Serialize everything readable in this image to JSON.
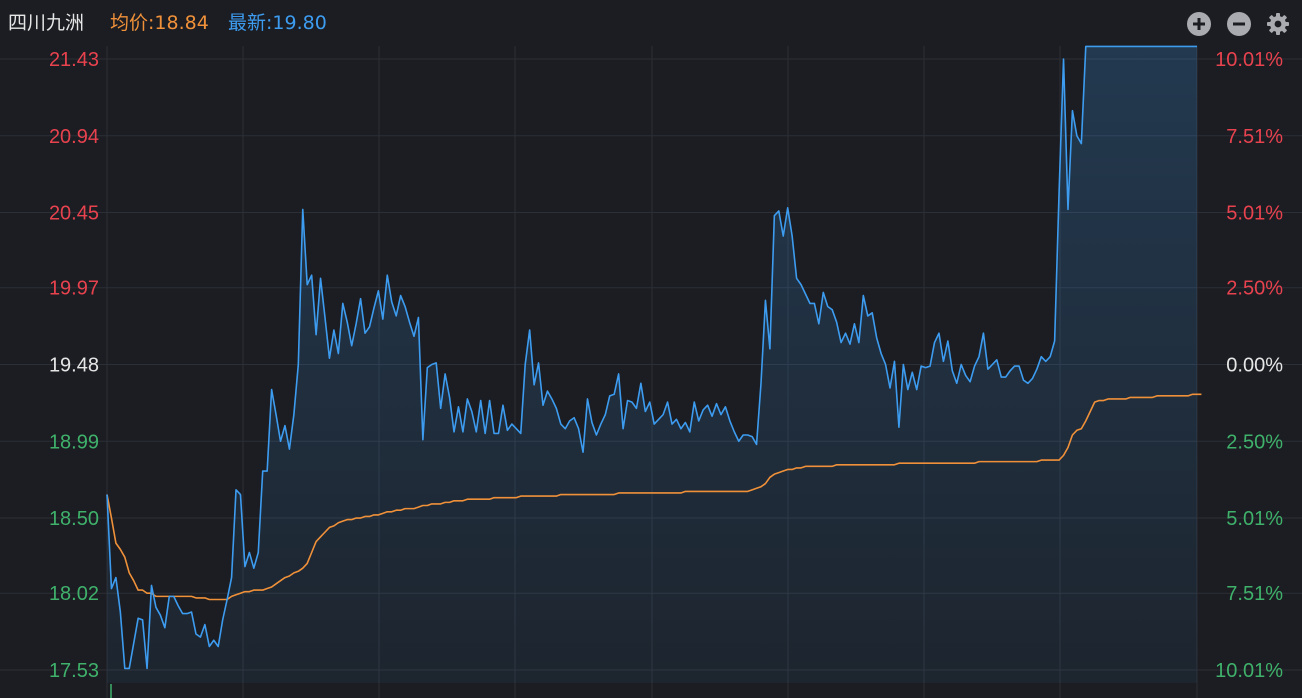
{
  "header": {
    "stock_name": "四川九洲",
    "avg_price_text": "均价:18.84",
    "latest_price_text": "最新:19.80"
  },
  "icons": {
    "zoom_in": "plus-circle-icon",
    "zoom_out": "minus-circle-icon",
    "settings": "gear-icon"
  },
  "colors": {
    "background": "#1b1d22",
    "price_line": "#3d9cf0",
    "avg_line": "#f0913a",
    "up": "#e8424f",
    "down": "#3fb16b",
    "neutral": "#e6e6e6",
    "grid": "#2c2f36"
  },
  "chart_data": {
    "type": "line",
    "title": "",
    "xlabel": "",
    "ylabel": "",
    "prev_close": 19.48,
    "ylim": [
      17.53,
      21.43
    ],
    "y_ticks_left": [
      "21.43",
      "20.94",
      "20.45",
      "19.97",
      "19.48",
      "18.99",
      "18.50",
      "18.02",
      "17.53"
    ],
    "y_ticks_left_values": [
      21.43,
      20.94,
      20.45,
      19.97,
      19.48,
      18.99,
      18.5,
      18.02,
      17.53
    ],
    "y_ticks_right": [
      "10.01%",
      "7.51%",
      "5.01%",
      "2.50%",
      "0.00%",
      "2.50%",
      "5.01%",
      "7.51%",
      "10.01%"
    ],
    "y_ticks_right_sign": [
      "up",
      "up",
      "up",
      "up",
      "neutral",
      "down",
      "down",
      "down",
      "down"
    ],
    "grid": true,
    "legend": "none",
    "series": [
      {
        "name": "最新",
        "color": "#3d9cf0",
        "values": [
          18.65,
          18.05,
          18.12,
          17.9,
          17.54,
          17.54,
          17.7,
          17.86,
          17.85,
          17.54,
          18.07,
          17.93,
          17.88,
          17.8,
          18.0,
          18.0,
          17.94,
          17.89,
          17.89,
          17.9,
          17.76,
          17.74,
          17.82,
          17.68,
          17.72,
          17.68,
          17.85,
          17.98,
          18.12,
          18.68,
          18.65,
          18.19,
          18.28,
          18.18,
          18.28,
          18.8,
          18.8,
          19.32,
          19.16,
          18.99,
          19.09,
          18.94,
          19.16,
          19.48,
          20.47,
          19.99,
          20.05,
          19.67,
          20.03,
          19.78,
          19.52,
          19.7,
          19.55,
          19.87,
          19.75,
          19.6,
          19.74,
          19.9,
          19.68,
          19.72,
          19.84,
          19.95,
          19.77,
          20.05,
          19.88,
          19.79,
          19.92,
          19.85,
          19.75,
          19.66,
          19.78,
          19.0,
          19.46,
          19.48,
          19.49,
          19.2,
          19.42,
          19.27,
          19.05,
          19.21,
          19.05,
          19.26,
          19.18,
          19.05,
          19.25,
          19.04,
          19.25,
          19.04,
          19.04,
          19.22,
          19.06,
          19.1,
          19.07,
          19.04,
          19.48,
          19.7,
          19.35,
          19.49,
          19.22,
          19.31,
          19.26,
          19.2,
          19.1,
          19.07,
          19.12,
          19.14,
          19.07,
          18.92,
          19.26,
          19.11,
          19.03,
          19.1,
          19.16,
          19.28,
          19.29,
          19.42,
          19.07,
          19.25,
          19.24,
          19.2,
          19.36,
          19.18,
          19.24,
          19.1,
          19.13,
          19.16,
          19.24,
          19.1,
          19.13,
          19.07,
          19.11,
          19.05,
          19.24,
          19.12,
          19.19,
          19.22,
          19.15,
          19.23,
          19.16,
          19.21,
          19.12,
          19.05,
          18.99,
          19.03,
          19.03,
          19.02,
          18.97,
          19.36,
          19.89,
          19.58,
          20.43,
          20.46,
          20.3,
          20.48,
          20.3,
          20.03,
          19.99,
          19.93,
          19.87,
          19.87,
          19.74,
          19.94,
          19.85,
          19.83,
          19.75,
          19.62,
          19.68,
          19.61,
          19.74,
          19.62,
          19.92,
          19.79,
          19.81,
          19.65,
          19.55,
          19.48,
          19.33,
          19.5,
          19.08,
          19.48,
          19.32,
          19.43,
          19.32,
          19.47,
          19.46,
          19.47,
          19.62,
          19.68,
          19.5,
          19.63,
          19.44,
          19.36,
          19.48,
          19.41,
          19.37,
          19.47,
          19.53,
          19.68,
          19.45,
          19.48,
          19.51,
          19.4,
          19.4,
          19.44,
          19.47,
          19.47,
          19.38,
          19.36,
          19.39,
          19.45,
          19.53,
          19.5,
          19.53,
          19.63,
          20.58,
          21.43,
          20.47,
          21.1,
          20.94,
          20.89,
          21.51,
          21.51,
          21.51,
          21.51,
          21.51,
          21.51,
          21.51,
          21.51,
          21.51,
          21.51,
          21.51,
          21.51,
          21.51,
          21.51,
          21.51,
          21.51,
          21.51,
          21.51,
          21.51,
          21.51,
          21.51,
          21.51,
          21.51,
          21.51,
          21.51,
          21.51
        ]
      },
      {
        "name": "均价",
        "color": "#f0913a",
        "values": [
          18.65,
          18.5,
          18.34,
          18.3,
          18.25,
          18.15,
          18.1,
          18.04,
          18.04,
          18.02,
          18.02,
          18.0,
          18.0,
          18.0,
          18.0,
          18.0,
          18.0,
          18.0,
          18.0,
          18.0,
          17.99,
          17.99,
          17.99,
          17.98,
          17.98,
          17.98,
          17.98,
          17.98,
          18.0,
          18.01,
          18.02,
          18.03,
          18.03,
          18.04,
          18.04,
          18.04,
          18.05,
          18.06,
          18.08,
          18.1,
          18.12,
          18.13,
          18.15,
          18.16,
          18.18,
          18.21,
          18.28,
          18.35,
          18.38,
          18.41,
          18.44,
          18.45,
          18.47,
          18.48,
          18.49,
          18.49,
          18.5,
          18.5,
          18.51,
          18.51,
          18.52,
          18.52,
          18.53,
          18.54,
          18.54,
          18.55,
          18.55,
          18.56,
          18.56,
          18.56,
          18.57,
          18.58,
          18.58,
          18.59,
          18.59,
          18.59,
          18.6,
          18.6,
          18.61,
          18.61,
          18.61,
          18.62,
          18.62,
          18.62,
          18.62,
          18.62,
          18.62,
          18.63,
          18.63,
          18.63,
          18.63,
          18.63,
          18.63,
          18.64,
          18.64,
          18.64,
          18.64,
          18.64,
          18.64,
          18.64,
          18.64,
          18.64,
          18.65,
          18.65,
          18.65,
          18.65,
          18.65,
          18.65,
          18.65,
          18.65,
          18.65,
          18.65,
          18.65,
          18.65,
          18.65,
          18.66,
          18.66,
          18.66,
          18.66,
          18.66,
          18.66,
          18.66,
          18.66,
          18.66,
          18.66,
          18.66,
          18.66,
          18.66,
          18.66,
          18.66,
          18.67,
          18.67,
          18.67,
          18.67,
          18.67,
          18.67,
          18.67,
          18.67,
          18.67,
          18.67,
          18.67,
          18.67,
          18.67,
          18.67,
          18.67,
          18.68,
          18.69,
          18.7,
          18.72,
          18.76,
          18.78,
          18.79,
          18.8,
          18.81,
          18.81,
          18.82,
          18.82,
          18.83,
          18.83,
          18.83,
          18.83,
          18.83,
          18.83,
          18.83,
          18.84,
          18.84,
          18.84,
          18.84,
          18.84,
          18.84,
          18.84,
          18.84,
          18.84,
          18.84,
          18.84,
          18.84,
          18.84,
          18.84,
          18.85,
          18.85,
          18.85,
          18.85,
          18.85,
          18.85,
          18.85,
          18.85,
          18.85,
          18.85,
          18.85,
          18.85,
          18.85,
          18.85,
          18.85,
          18.85,
          18.85,
          18.85,
          18.86,
          18.86,
          18.86,
          18.86,
          18.86,
          18.86,
          18.86,
          18.86,
          18.86,
          18.86,
          18.86,
          18.86,
          18.86,
          18.86,
          18.87,
          18.87,
          18.87,
          18.87,
          18.87,
          18.9,
          18.95,
          19.03,
          19.06,
          19.07,
          19.12,
          19.18,
          19.24,
          19.25,
          19.25,
          19.26,
          19.26,
          19.26,
          19.26,
          19.26,
          19.27,
          19.27,
          19.27,
          19.27,
          19.27,
          19.27,
          19.28,
          19.28,
          19.28,
          19.28,
          19.28,
          19.28,
          19.28,
          19.28,
          19.29,
          19.29,
          19.29
        ]
      }
    ]
  }
}
